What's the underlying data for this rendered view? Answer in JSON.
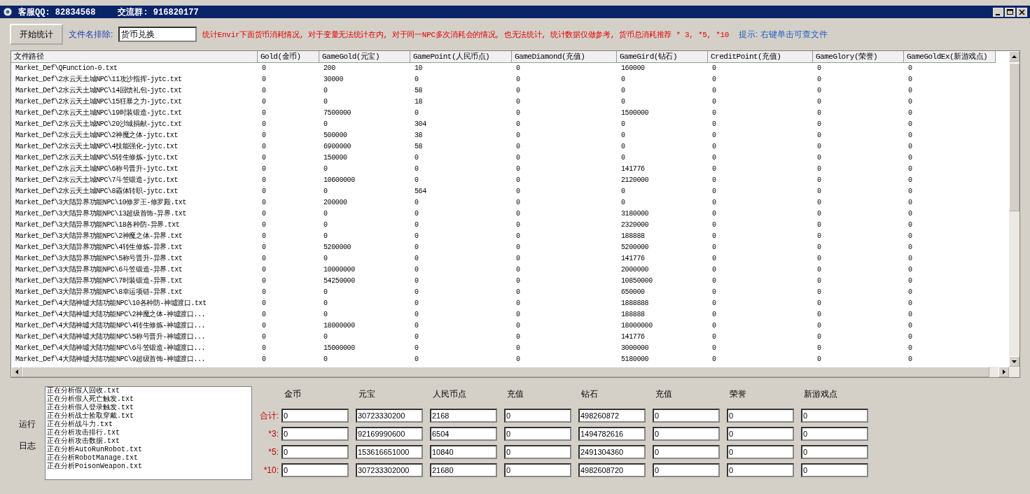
{
  "window": {
    "title_items": [
      "客服QQ: 82834568",
      "交流群: 916820177"
    ]
  },
  "toolbar": {
    "start_button": "开始统计",
    "exclude_label": "文件名排除:",
    "exclude_value": "货币兑换",
    "note": "统计Envir下面货币消耗情况, 对于变量无法统计在内, 对于同一NPC多次消耗会的情况, 也无法统计, 统计数据仅做参考, 货币总消耗推荐 * 3, *5, *10",
    "hint": "提示: 右键单击可查文件"
  },
  "table": {
    "columns": [
      "文件路径",
      "Gold(金币)",
      "GameGold(元宝)",
      "GamePoint(人民币点)",
      "GameDiamond(充值)",
      "GameGird(钻石)",
      "CreditPoint(充值)",
      "GameGlory(荣誉)",
      "GameGoldEx(新游戏点)"
    ],
    "rows": [
      [
        "Market_Def\\QFunction-0.txt",
        "0",
        "200",
        "10",
        "0",
        "160000",
        "0",
        "0",
        "0"
      ],
      [
        "Market_Def\\2水云天土城NPC\\11攻沙指挥-jytc.txt",
        "0",
        "30000",
        "0",
        "0",
        "0",
        "0",
        "0",
        "0"
      ],
      [
        "Market_Def\\2水云天土城NPC\\14回馈礼包-jytc.txt",
        "0",
        "0",
        "58",
        "0",
        "0",
        "0",
        "0",
        "0"
      ],
      [
        "Market_Def\\2水云天土城NPC\\15狂暴之力-jytc.txt",
        "0",
        "0",
        "18",
        "0",
        "0",
        "0",
        "0",
        "0"
      ],
      [
        "Market_Def\\2水云天土城NPC\\19时装锻造-jytc.txt",
        "0",
        "7500000",
        "0",
        "0",
        "1500000",
        "0",
        "0",
        "0"
      ],
      [
        "Market_Def\\2水云天土城NPC\\20沙城捐献-jytc.txt",
        "0",
        "0",
        "304",
        "0",
        "0",
        "0",
        "0",
        "0"
      ],
      [
        "Market_Def\\2水云天土城NPC\\2神魔之体-jytc.txt",
        "0",
        "500000",
        "38",
        "0",
        "0",
        "0",
        "0",
        "0"
      ],
      [
        "Market_Def\\2水云天土城NPC\\4技能强化-jytc.txt",
        "0",
        "6900000",
        "58",
        "0",
        "0",
        "0",
        "0",
        "0"
      ],
      [
        "Market_Def\\2水云天土城NPC\\5转生修炼-jytc.txt",
        "0",
        "150000",
        "0",
        "0",
        "0",
        "0",
        "0",
        "0"
      ],
      [
        "Market_Def\\2水云天土城NPC\\6称号晋升-jytc.txt",
        "0",
        "0",
        "0",
        "0",
        "141776",
        "0",
        "0",
        "0"
      ],
      [
        "Market_Def\\2水云天土城NPC\\7斗笠锻造-jytc.txt",
        "0",
        "10600000",
        "0",
        "0",
        "2120000",
        "0",
        "0",
        "0"
      ],
      [
        "Market_Def\\2水云天土城NPC\\8霸体转职-jytc.txt",
        "0",
        "0",
        "564",
        "0",
        "0",
        "0",
        "0",
        "0"
      ],
      [
        "Market_Def\\3大陆异界功能NPC\\10修罗王-修罗殿.txt",
        "0",
        "200000",
        "0",
        "0",
        "0",
        "0",
        "0",
        "0"
      ],
      [
        "Market_Def\\3大陆异界功能NPC\\13超级首饰-异界.txt",
        "0",
        "0",
        "0",
        "0",
        "3180000",
        "0",
        "0",
        "0"
      ],
      [
        "Market_Def\\3大陆异界功能NPC\\18各种防-异界.txt",
        "0",
        "0",
        "0",
        "0",
        "2320000",
        "0",
        "0",
        "0"
      ],
      [
        "Market_Def\\3大陆异界功能NPC\\2神魔之体-异界.txt",
        "0",
        "0",
        "0",
        "0",
        "188888",
        "0",
        "0",
        "0"
      ],
      [
        "Market_Def\\3大陆异界功能NPC\\4转生修炼-异界.txt",
        "0",
        "5200000",
        "0",
        "0",
        "5200000",
        "0",
        "0",
        "0"
      ],
      [
        "Market_Def\\3大陆异界功能NPC\\5称号晋升-异界.txt",
        "0",
        "0",
        "0",
        "0",
        "141776",
        "0",
        "0",
        "0"
      ],
      [
        "Market_Def\\3大陆异界功能NPC\\6斗笠锻造-异界.txt",
        "0",
        "10000000",
        "0",
        "0",
        "2000000",
        "0",
        "0",
        "0"
      ],
      [
        "Market_Def\\3大陆异界功能NPC\\7时装锻造-异界.txt",
        "0",
        "54250000",
        "0",
        "0",
        "10850000",
        "0",
        "0",
        "0"
      ],
      [
        "Market_Def\\3大陆异界功能NPC\\8幸运项链-异界.txt",
        "0",
        "0",
        "0",
        "0",
        "650000",
        "0",
        "0",
        "0"
      ],
      [
        "Market_Def\\4大陆神墟大陆功能NPC\\10各种防-神墟渡口.txt",
        "0",
        "0",
        "0",
        "0",
        "1888888",
        "0",
        "0",
        "0"
      ],
      [
        "Market_Def\\4大陆神墟大陆功能NPC\\2神魔之体-神墟渡口...",
        "0",
        "0",
        "0",
        "0",
        "188888",
        "0",
        "0",
        "0"
      ],
      [
        "Market_Def\\4大陆神墟大陆功能NPC\\4转生修炼-神墟渡口...",
        "0",
        "18000000",
        "0",
        "0",
        "18000000",
        "0",
        "0",
        "0"
      ],
      [
        "Market_Def\\4大陆神墟大陆功能NPC\\5称号晋升-神墟渡口...",
        "0",
        "0",
        "0",
        "0",
        "141776",
        "0",
        "0",
        "0"
      ],
      [
        "Market_Def\\4大陆神墟大陆功能NPC\\6斗笠锻造-神墟渡口...",
        "0",
        "15000000",
        "0",
        "0",
        "3000000",
        "0",
        "0",
        "0"
      ],
      [
        "Market_Def\\4大陆神墟大陆功能NPC\\9超级首饰-神墟渡口...",
        "0",
        "0",
        "0",
        "0",
        "5180000",
        "0",
        "0",
        "0"
      ]
    ]
  },
  "log": {
    "label_lines": [
      "运行",
      "日志"
    ],
    "lines": [
      "正在分析假人回收.txt",
      "正在分析假人死亡触发.txt",
      "正在分析假人登录触发.txt",
      "正在分析战士捡取穿戴.txt",
      "正在分析战斗力.txt",
      "正在分析攻击排行.txt",
      "正在分析攻击数据.txt",
      "正在分析AutoRunRobot.txt",
      "正在分析RobotManage.txt",
      "正在分析PoisonWeapon.txt"
    ]
  },
  "summary": {
    "columns": [
      "金币",
      "元宝",
      "人民币点",
      "充值",
      "钻石",
      "充值",
      "荣誉",
      "新游戏点"
    ],
    "rows": [
      {
        "label": "合计:",
        "values": [
          "0",
          "30723330200",
          "2168",
          "0",
          "498260872",
          "0",
          "0",
          "0"
        ]
      },
      {
        "label": "*3:",
        "values": [
          "0",
          "92169990600",
          "6504",
          "0",
          "1494782616",
          "0",
          "0",
          "0"
        ]
      },
      {
        "label": "*5:",
        "values": [
          "0",
          "153616651000",
          "10840",
          "0",
          "2491304360",
          "0",
          "0",
          "0"
        ]
      },
      {
        "label": "*10:",
        "values": [
          "0",
          "307233302000",
          "21680",
          "0",
          "4982608720",
          "0",
          "0",
          "0"
        ]
      }
    ]
  }
}
